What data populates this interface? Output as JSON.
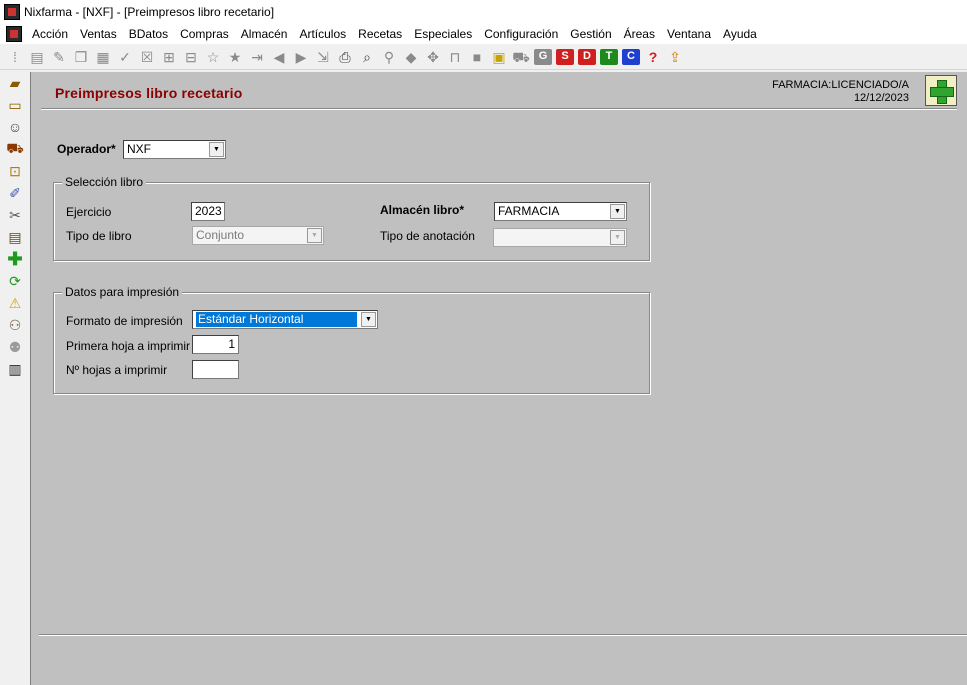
{
  "window": {
    "title": "Nixfarma - [NXF] - [Preimpresos libro recetario]"
  },
  "menu": [
    "Acción",
    "Ventas",
    "BDatos",
    "Compras",
    "Almacén",
    "Artículos",
    "Recetas",
    "Especiales",
    "Configuración",
    "Gestión",
    "Áreas",
    "Ventana",
    "Ayuda"
  ],
  "toolbar": {
    "letter_buttons": [
      {
        "label": "G",
        "color": "#8a8a8a"
      },
      {
        "label": "S",
        "color": "#d11f1f"
      },
      {
        "label": "D",
        "color": "#d11f1f"
      },
      {
        "label": "T",
        "color": "#1e8a1e"
      },
      {
        "label": "C",
        "color": "#1f3fd1"
      }
    ],
    "help_glyph": "?"
  },
  "header": {
    "title": "Preimpresos libro recetario",
    "user": "FARMACIA:LICENCIADO/A",
    "date": "12/12/2023"
  },
  "form": {
    "operador_label": "Operador*",
    "operador_value": "NXF",
    "seleccion": {
      "title": "Selección libro",
      "ejercicio_label": "Ejercicio",
      "ejercicio_value": "2023",
      "tipo_libro_label": "Tipo de libro",
      "tipo_libro_value": "Conjunto",
      "almacen_label": "Almacén libro*",
      "almacen_value": "FARMACIA",
      "tipo_anotacion_label": "Tipo de anotación",
      "tipo_anotacion_value": ""
    },
    "impresion": {
      "title": "Datos para impresión",
      "formato_label": "Formato de impresión",
      "formato_value": "Estándar Horizontal",
      "primera_label": "Primera hoja a imprimir",
      "primera_value": "1",
      "hojas_label": "Nº  hojas a imprimir",
      "hojas_value": ""
    }
  },
  "colors": {
    "title": "#8b0000",
    "panel": "#c0c0c0",
    "add": "#2fa52f"
  }
}
